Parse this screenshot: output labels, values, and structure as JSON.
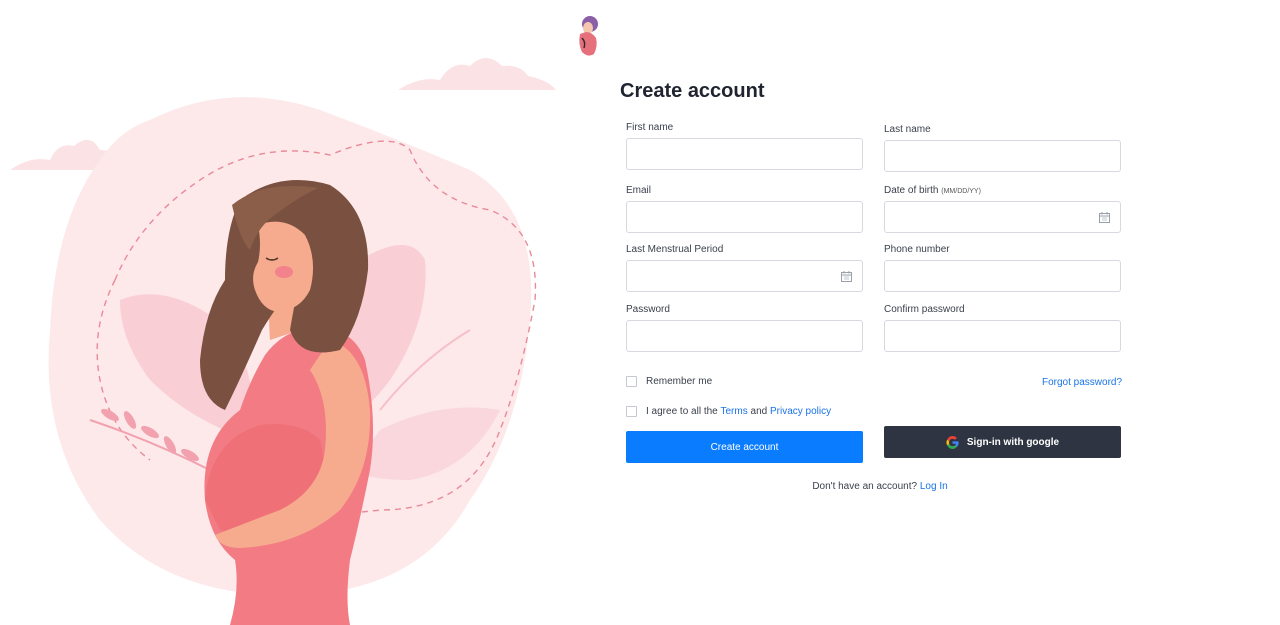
{
  "brand": {
    "logo_icon": "pregnant-woman-logo-icon"
  },
  "form": {
    "title": "Create account",
    "fields": {
      "first_name": {
        "label": "First name",
        "value": ""
      },
      "last_name": {
        "label": "Last name",
        "value": ""
      },
      "email": {
        "label": "Email",
        "value": ""
      },
      "dob": {
        "label": "Date of birth",
        "hint": "(MM/DD/YY)",
        "value": ""
      },
      "lmp": {
        "label": "Last Menstrual Period",
        "value": ""
      },
      "phone": {
        "label": "Phone  number",
        "value": ""
      },
      "password": {
        "label": "Password",
        "value": ""
      },
      "confirm_password": {
        "label": "Confirm password",
        "value": ""
      }
    },
    "remember_me": "Remember me",
    "forgot_password": "Forgot password?",
    "agree_prefix": "I agree to all the",
    "terms": "Terms",
    "agree_and": "and",
    "privacy": "Privacy policy",
    "create_button": "Create account",
    "google_button": "Sign-in with google",
    "no_account": "Don't have an account?",
    "login_link": "Log In"
  },
  "colors": {
    "primary": "#0a7cff",
    "google_button_bg": "#2e3442",
    "illustration_pink": "#f37c84",
    "illustration_bg": "#fde8ea",
    "hair": "#7a5140"
  }
}
